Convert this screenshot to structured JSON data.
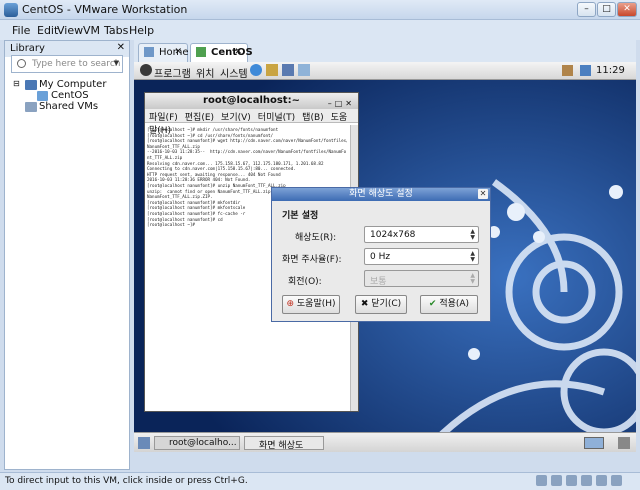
{
  "window": {
    "title": "CentOS - VMware Workstation"
  },
  "menu": [
    "File",
    "Edit",
    "View",
    "VM",
    "Tabs",
    "Help"
  ],
  "library": {
    "title": "Library",
    "search_placeholder": "Type here to search",
    "tree": [
      "My Computer",
      "CentOS",
      "Shared VMs"
    ]
  },
  "tabs": [
    {
      "label": "Home"
    },
    {
      "label": "CentOS"
    }
  ],
  "guest": {
    "panel_menu": [
      "프로그램",
      "위치",
      "시스템"
    ],
    "clock": "11:29",
    "terminal": {
      "title": "root@localhost:~",
      "menu": [
        "파일(F)",
        "편집(E)",
        "보기(V)",
        "터미널(T)",
        "탭(B)",
        "도움말(H)"
      ],
      "lines": [
        "[root@localhost ~]# mkdir /usr/share/fonts/nanumfont",
        "[root@localhost ~]# cd /usr/share/fonts/nanumfont/",
        "[root@localhost nanumfont]# wget http://cdn.naver.com/naver/NanumFont/fontfiles/",
        "NanumFont_TTF_ALL.zip",
        "--2016-10-03 11:28:35--  http://cdn.naver.com/naver/NanumFont/fontfiles/NanumFo",
        "nt_TTF_ALL.zip",
        "Resolving cdn.naver.com... 175.158.15.67, 112.175.180.171, 1.201.68.82",
        "Connecting to cdn.naver.com|175.158.15.67|:80... connected.",
        "HTTP request sent, awaiting response... 404 Not Found",
        "2016-10-03 11:28:36 ERROR 404: Not Found.",
        "",
        "[root@localhost nanumfont]# unzip NanumFont_TTF_ALL.zip",
        "unzip:  cannot find or open NanumFont_TTF_ALL.zip, NanumFont_TTF_ALL.zip.zip or",
        "NanumFont_TTF_ALL.zip.ZIP.",
        "[root@localhost nanumfont]# mkfontdir",
        "[root@localhost nanumfont]# mkfontscale",
        "[root@localhost nanumfont]# fc-cache -r",
        "[root@localhost nanumfont]# cd",
        "[root@localhost ~]# "
      ]
    },
    "dialog": {
      "title": "화면 해상도 설정",
      "section": "기본 설정",
      "resolution_label": "해상도(R):",
      "resolution_value": "1024x768",
      "refresh_label": "화면 주사율(F):",
      "refresh_value": "0 Hz",
      "rotation_label": "회전(O):",
      "rotation_value": "보통",
      "help_button": "도움말(H)",
      "close_button": "닫기(C)",
      "apply_button": "적용(A)"
    },
    "taskbar": [
      {
        "label": "root@localho..."
      },
      {
        "label": "화면 해상도 설..."
      }
    ]
  },
  "status": {
    "text": "To direct input to this VM, click inside or press Ctrl+G."
  }
}
